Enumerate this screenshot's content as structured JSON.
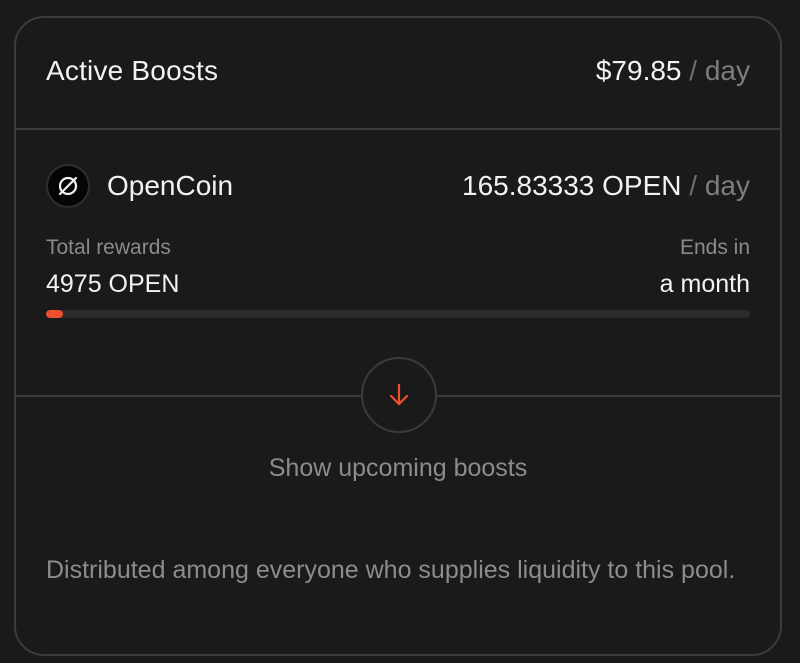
{
  "header": {
    "title": "Active Boosts",
    "rate_value": "$79.85",
    "rate_separator": "/",
    "rate_unit": "day"
  },
  "token": {
    "icon": "slashed-circle-icon",
    "name": "OpenCoin",
    "rate_value": "165.83333 OPEN",
    "rate_separator": "/",
    "rate_unit": "day"
  },
  "stats": {
    "total_rewards_label": "Total rewards",
    "total_rewards_value": "4975 OPEN",
    "ends_in_label": "Ends in",
    "ends_in_value": "a month"
  },
  "progress": {
    "fraction": 0.024,
    "color": "#ee4f2e"
  },
  "upcoming": {
    "icon": "arrow-down-icon",
    "label": "Show upcoming boosts"
  },
  "footnote": "Distributed among everyone who supplies liquidity to this pool.",
  "colors": {
    "background": "#1a1a1a",
    "border": "#3b3b3b",
    "accent": "#ee4f2e",
    "muted_text": "#8c8c8c",
    "primary_text": "#f2f2f2"
  }
}
